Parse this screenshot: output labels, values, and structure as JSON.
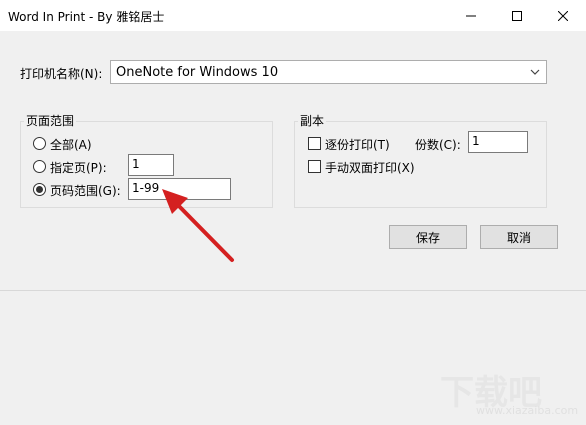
{
  "window": {
    "title": "Word In Print - By 雅铭居士",
    "controls": {
      "minimize": "minimize-icon",
      "maximize": "maximize-icon",
      "close": "close-icon"
    }
  },
  "printer": {
    "label": "打印机名称(N):",
    "selected": "OneNote for Windows 10"
  },
  "page_range": {
    "title": "页面范围",
    "options": [
      {
        "label": "全部(A)",
        "checked": false
      },
      {
        "label": "指定页(P):",
        "checked": false,
        "value": "1"
      },
      {
        "label": "页码范围(G):",
        "checked": true,
        "value": "1-99"
      }
    ]
  },
  "copies": {
    "title": "副本",
    "collate_label": "逐份打印(T)",
    "collate_checked": false,
    "count_label": "份数(C):",
    "count_value": "1",
    "duplex_label": "手动双面打印(X)",
    "duplex_checked": false
  },
  "buttons": {
    "save": "保存",
    "cancel": "取消"
  },
  "annotation": {
    "icon": "red-arrow-pointer",
    "color": "#d42020"
  },
  "watermark": {
    "text": "下载吧",
    "url": "www.xiazaiba.com"
  }
}
